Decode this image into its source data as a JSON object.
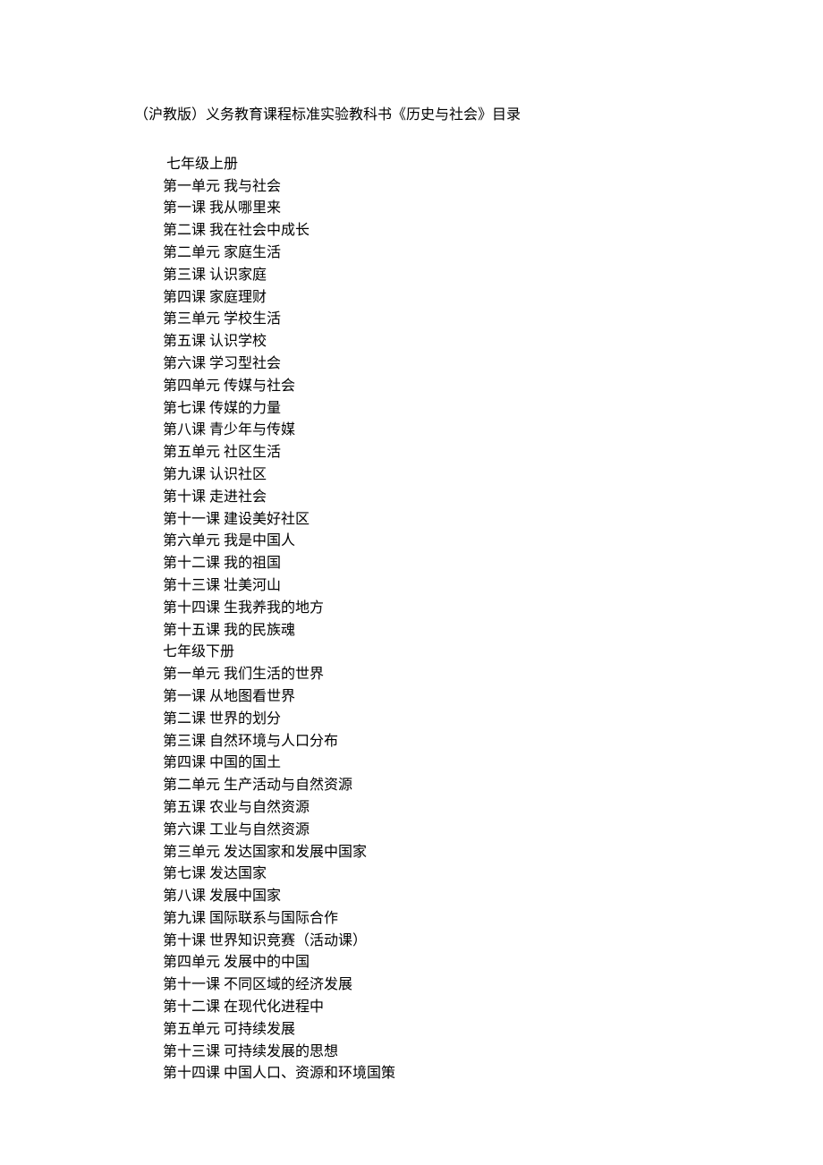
{
  "title": "（沪教版）义务教育课程标准实验教科书《历史与社会》目录",
  "lines": [
    " 七年级上册",
    "第一单元 我与社会",
    "第一课 我从哪里来",
    "第二课 我在社会中成长",
    "第二单元 家庭生活",
    "第三课 认识家庭",
    "第四课 家庭理财",
    "第三单元 学校生活",
    "第五课 认识学校",
    "第六课 学习型社会",
    "第四单元 传媒与社会",
    "第七课 传媒的力量",
    "第八课 青少年与传媒",
    "第五单元 社区生活",
    "第九课 认识社区",
    "第十课 走进社会",
    "第十一课 建设美好社区",
    "第六单元 我是中国人",
    "第十二课 我的祖国",
    "第十三课 壮美河山",
    "第十四课 生我养我的地方",
    "第十五课 我的民族魂",
    "七年级下册",
    "第一单元 我们生活的世界",
    "第一课 从地图看世界",
    "第二课 世界的划分",
    "第三课 自然环境与人口分布",
    "第四课 中国的国土",
    "第二单元 生产活动与自然资源",
    "第五课 农业与自然资源",
    "第六课 工业与自然资源",
    "第三单元 发达国家和发展中国家",
    "第七课 发达国家",
    "第八课 发展中国家",
    "第九课 国际联系与国际合作",
    "第十课 世界知识竞赛（活动课）",
    "第四单元 发展中的中国",
    "第十一课 不同区域的经济发展",
    "第十二课 在现代化进程中",
    "第五单元 可持续发展",
    "第十三课 可持续发展的思想",
    "第十四课 中国人口、资源和环境国策"
  ]
}
